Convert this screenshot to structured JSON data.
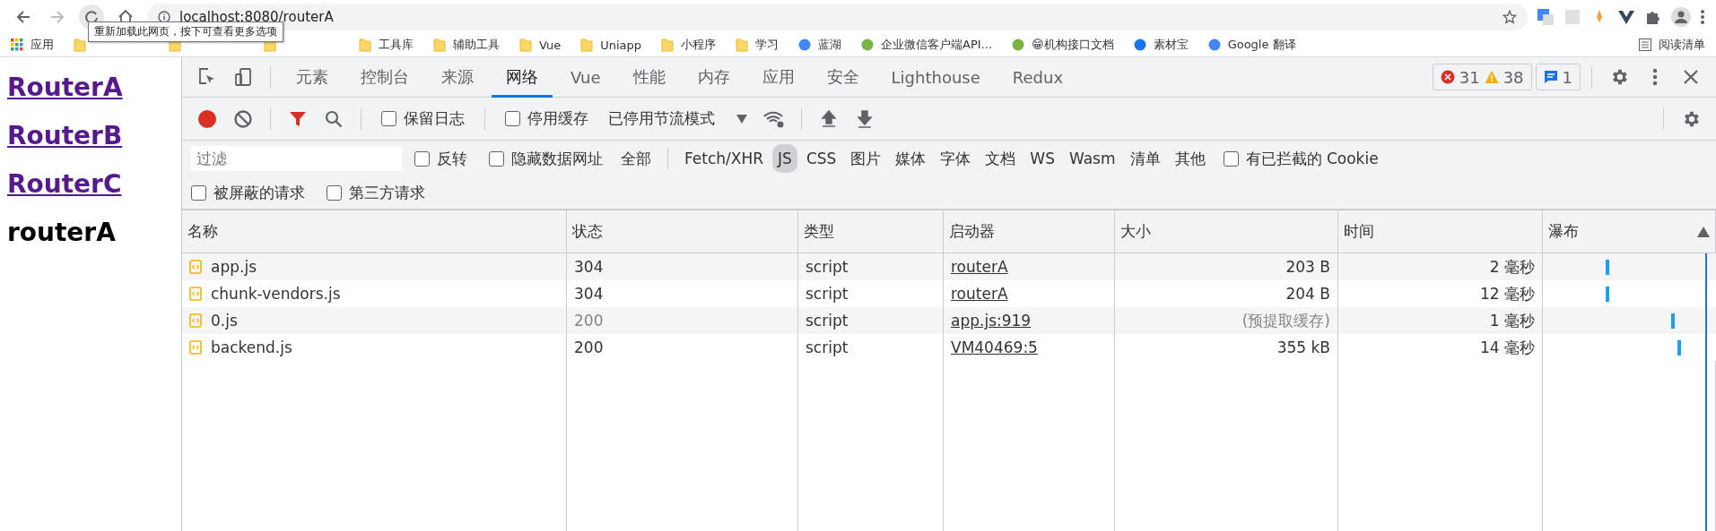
{
  "browser": {
    "url": "localhost:8080/routerA",
    "tooltip": "重新加载此网页，按下可查看更多选项"
  },
  "bookmarks": [
    {
      "label": "应用",
      "kind": "apps"
    },
    {
      "kind": "hidden"
    },
    {
      "kind": "hidden"
    },
    {
      "kind": "hidden"
    },
    {
      "label": "工具库",
      "kind": "folder"
    },
    {
      "label": "辅助工具",
      "kind": "folder"
    },
    {
      "label": "Vue",
      "kind": "folder"
    },
    {
      "label": "Uniapp",
      "kind": "folder"
    },
    {
      "label": "小程序",
      "kind": "folder"
    },
    {
      "label": "学习",
      "kind": "folder"
    },
    {
      "label": "蓝湖",
      "kind": "site"
    },
    {
      "label": "企业微信客户端API...",
      "kind": "site"
    },
    {
      "label": "😁机构接口文档",
      "kind": "site"
    },
    {
      "label": "素材宝",
      "kind": "site"
    },
    {
      "label": "Google 翻译",
      "kind": "site"
    }
  ],
  "reading_list": "阅读清单",
  "page": {
    "links": [
      "RouterA",
      "RouterB",
      "RouterC"
    ],
    "heading": "routerA"
  },
  "devtools": {
    "tabs": [
      {
        "label": "元素",
        "selected": false
      },
      {
        "label": "控制台",
        "selected": false
      },
      {
        "label": "来源",
        "selected": false
      },
      {
        "label": "网络",
        "selected": true
      },
      {
        "label": "Vue",
        "selected": false
      },
      {
        "label": "性能",
        "selected": false
      },
      {
        "label": "内存",
        "selected": false
      },
      {
        "label": "应用",
        "selected": false
      },
      {
        "label": "安全",
        "selected": false
      },
      {
        "label": "Lighthouse",
        "selected": false
      },
      {
        "label": "Redux",
        "selected": false
      }
    ],
    "errors": "31",
    "warnings": "38",
    "messages": "1",
    "toolbar": {
      "recording": true,
      "preserve_log": {
        "label": "保留日志",
        "checked": false
      },
      "disable_cache": {
        "label": "停用缓存",
        "checked": false
      },
      "throttling": "已停用节流模式"
    },
    "filter": {
      "placeholder": "过滤",
      "invert": {
        "label": "反转",
        "checked": false
      },
      "hide_data_urls": {
        "label": "隐藏数据网址",
        "checked": false
      },
      "types": [
        {
          "label": "全部",
          "selected": false
        },
        {
          "label": "Fetch/XHR",
          "selected": false
        },
        {
          "label": "JS",
          "selected": true
        },
        {
          "label": "CSS",
          "selected": false
        },
        {
          "label": "图片",
          "selected": false
        },
        {
          "label": "媒体",
          "selected": false
        },
        {
          "label": "字体",
          "selected": false
        },
        {
          "label": "文档",
          "selected": false
        },
        {
          "label": "WS",
          "selected": false
        },
        {
          "label": "Wasm",
          "selected": false
        },
        {
          "label": "清单",
          "selected": false
        },
        {
          "label": "其他",
          "selected": false
        }
      ],
      "blocked_cookies": {
        "label": "有已拦截的 Cookie",
        "checked": false
      },
      "blocked_requests": {
        "label": "被屏蔽的请求",
        "checked": false
      },
      "third_party": {
        "label": "第三方请求",
        "checked": false
      }
    },
    "table": {
      "columns": [
        "名称",
        "状态",
        "类型",
        "启动器",
        "大小",
        "时间",
        "瀑布"
      ],
      "rows": [
        {
          "name": "app.js",
          "status": "304",
          "type": "script",
          "initiator": "routerA",
          "size": "203 B",
          "time": "2 毫秒",
          "cached": false
        },
        {
          "name": "chunk-vendors.js",
          "status": "304",
          "type": "script",
          "initiator": "routerA",
          "size": "204 B",
          "time": "12 毫秒",
          "cached": false
        },
        {
          "name": "0.js",
          "status": "200",
          "type": "script",
          "initiator": "app.js:919",
          "size": "(预提取缓存)",
          "time": "1 毫秒",
          "cached": true
        },
        {
          "name": "backend.js",
          "status": "200",
          "type": "script",
          "initiator": "VM40469:5",
          "size": "355 kB",
          "time": "14 毫秒",
          "cached": false
        }
      ]
    }
  }
}
